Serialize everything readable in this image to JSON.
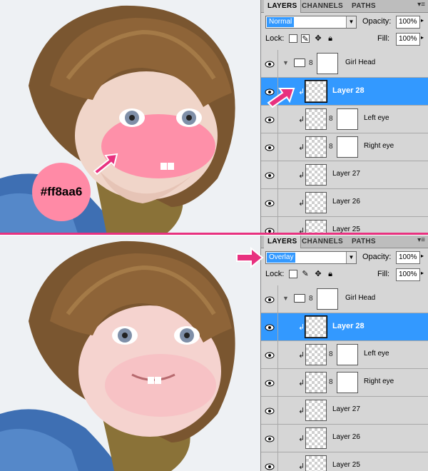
{
  "colors": {
    "pink_blush": "#ff8aa6",
    "divider": "#e8317f",
    "selection": "#3399ff"
  },
  "swatch": {
    "hex_label": "#ff8aa6"
  },
  "panels": [
    {
      "tabs": [
        "LAYERS",
        "CHANNELS",
        "PATHS"
      ],
      "blend_mode": "Normal",
      "opacity_label": "Opacity:",
      "opacity_value": "100%",
      "lock_label": "Lock:",
      "fill_label": "Fill:",
      "fill_value": "100%",
      "layers": [
        {
          "name": "Girl Head",
          "type": "group"
        },
        {
          "name": "Layer 28",
          "type": "layer",
          "selected": true
        },
        {
          "name": "Left eye",
          "type": "masked"
        },
        {
          "name": "Right eye",
          "type": "masked"
        },
        {
          "name": "Layer 27",
          "type": "layer"
        },
        {
          "name": "Layer 26",
          "type": "layer"
        },
        {
          "name": "Layer 25",
          "type": "layer"
        }
      ]
    },
    {
      "tabs": [
        "LAYERS",
        "CHANNELS",
        "PATHS"
      ],
      "blend_mode": "Overlay",
      "opacity_label": "Opacity:",
      "opacity_value": "100%",
      "lock_label": "Lock:",
      "fill_label": "Fill:",
      "fill_value": "100%",
      "layers": [
        {
          "name": "Girl Head",
          "type": "group"
        },
        {
          "name": "Layer 28",
          "type": "layer",
          "selected": true
        },
        {
          "name": "Left eye",
          "type": "masked"
        },
        {
          "name": "Right eye",
          "type": "masked"
        },
        {
          "name": "Layer 27",
          "type": "layer"
        },
        {
          "name": "Layer 26",
          "type": "layer"
        },
        {
          "name": "Layer 25",
          "type": "layer"
        }
      ]
    }
  ]
}
